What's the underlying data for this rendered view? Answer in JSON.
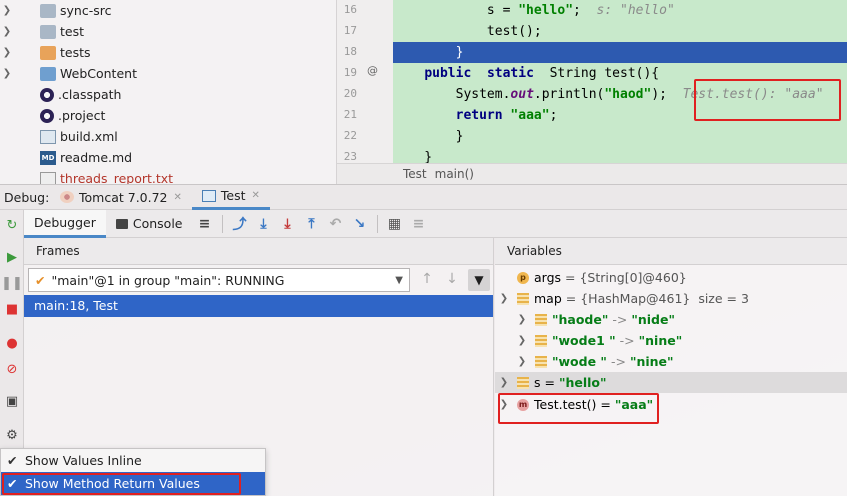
{
  "project_tree": {
    "items": [
      {
        "label": "sync-src",
        "icon": "folder-icon",
        "expandable": true
      },
      {
        "label": "test",
        "icon": "folder-icon",
        "expandable": true
      },
      {
        "label": "tests",
        "icon": "folder-icon",
        "expandable": true
      },
      {
        "label": "WebContent",
        "icon": "web-folder-icon",
        "expandable": true
      },
      {
        "label": ".classpath",
        "icon": "eclipse-icon",
        "expandable": false
      },
      {
        "label": ".project",
        "icon": "eclipse-icon",
        "expandable": false
      },
      {
        "label": "build.xml",
        "icon": "xml-icon",
        "expandable": false
      },
      {
        "label": "readme.md",
        "icon": "markdown-icon",
        "expandable": false
      },
      {
        "label": "threads_report.txt",
        "icon": "text-file-icon",
        "expandable": false
      }
    ]
  },
  "editor": {
    "line_numbers": [
      "16",
      "17",
      "18",
      "19",
      "20",
      "21",
      "22",
      "23"
    ],
    "override_marker": "@",
    "lines": {
      "l16_code": "            s = ",
      "l16_str": "\"hello\"",
      "l16_end": ";  ",
      "l16_hint": "s: \"hello\"",
      "l17_code": "            test();",
      "l18_code": "        }",
      "l19_kw1": "public",
      "l19_kw2": "static",
      "l19_rest": "String test(){",
      "l20_a": "System.",
      "l20_out": "out",
      "l20_b": ".println(",
      "l20_str": "\"haod\"",
      "l20_c": ");",
      "l20_hint": "Test.test(): \"aaa\"",
      "l21_kw": "return",
      "l21_str": "\"aaa\"",
      "l21_end": ";",
      "l22_code": "        }",
      "l23_code": "    }"
    },
    "breadcrumb": [
      "Test",
      "main()"
    ]
  },
  "debug": {
    "label": "Debug:",
    "tabs": [
      {
        "label": "Tomcat 7.0.72",
        "icon": "tomcat-icon"
      },
      {
        "label": "Test",
        "icon": "application-icon"
      }
    ],
    "sub_tabs": {
      "debugger": "Debugger",
      "console": "Console"
    },
    "frames": {
      "header": "Frames",
      "thread_selected": "\"main\"@1 in group \"main\": RUNNING",
      "frame_row": "main:18, Test"
    },
    "variables": {
      "header": "Variables",
      "rows": {
        "args_name": "args",
        "args_value": "= {String[0]@460}",
        "map_name": "map",
        "map_value": "= {HashMap@461}",
        "map_size": "size = 3",
        "e1_key": "\"haode\"",
        "e1_val": "\"nide\"",
        "e2_key": "\"wode1 \"",
        "e2_val": "\"nine\"",
        "e3_key": "\"wode \"",
        "e3_val": "\"nine\"",
        "arrow": "->",
        "s_name": "s",
        "s_eq": "=",
        "s_value": "\"hello\"",
        "ret_name": "Test.test()",
        "ret_eq": "=",
        "ret_value": "\"aaa\""
      }
    },
    "settings_menu": [
      {
        "label": "Show Values Inline",
        "checked": true
      },
      {
        "label": "Show Method Return Values",
        "checked": true,
        "selected": true
      }
    ]
  },
  "colors": {
    "execution_line": "#2d5ab0",
    "selection": "#2f65c7",
    "highlight_box": "#e02020",
    "code_bg": "#c8e9cb"
  }
}
